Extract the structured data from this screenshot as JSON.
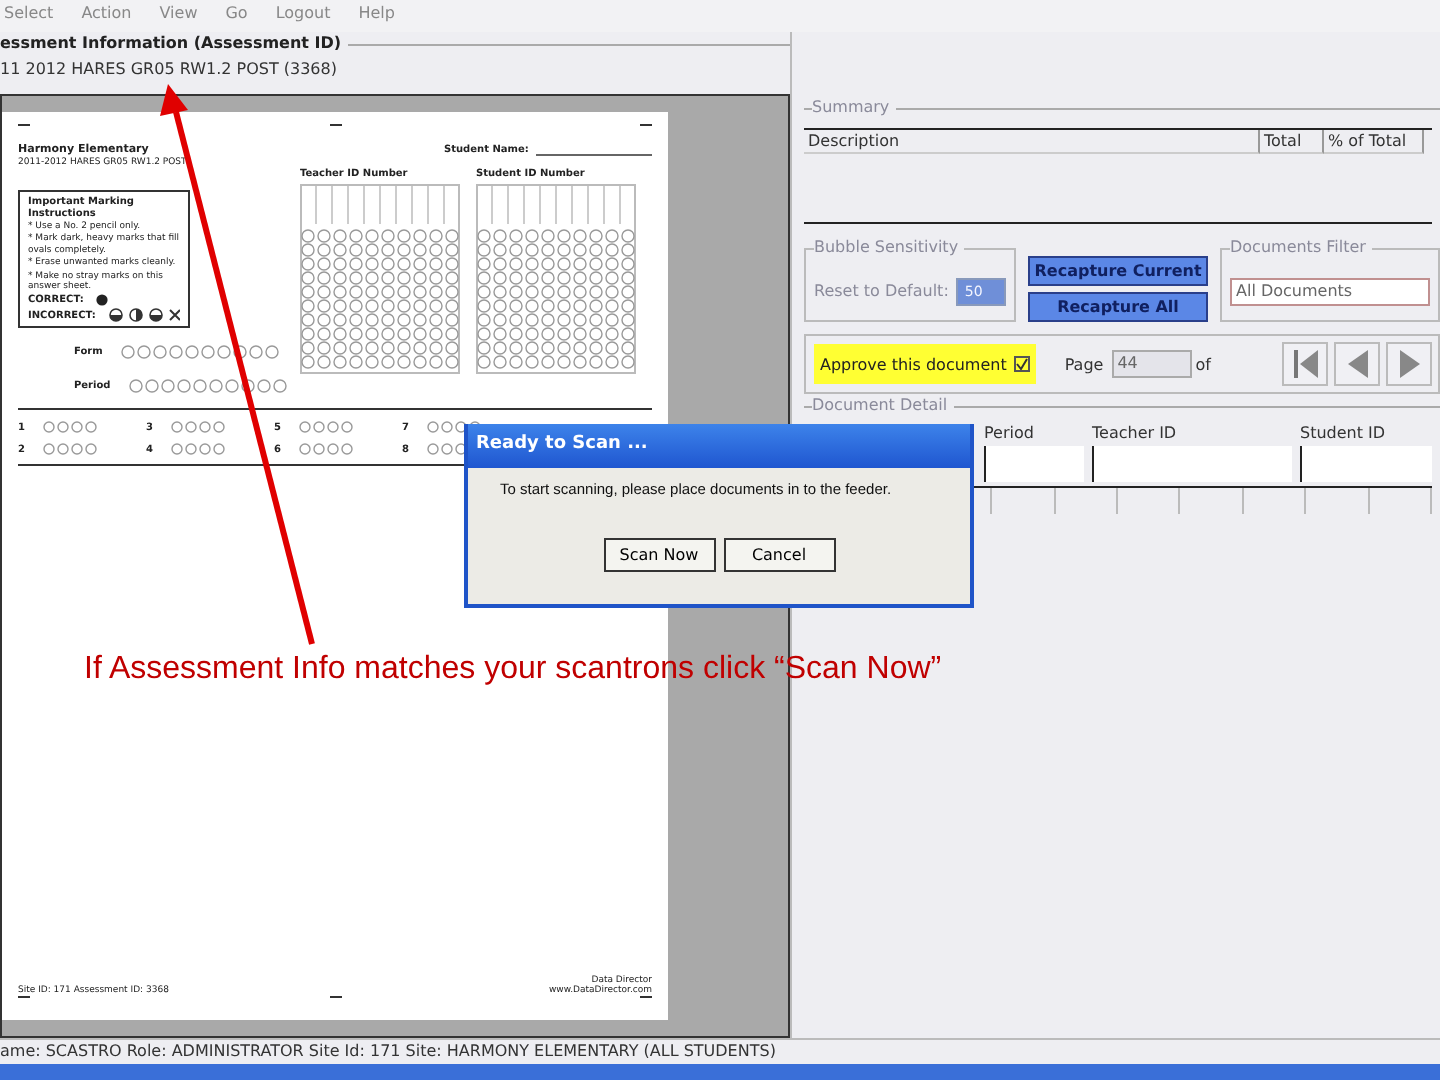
{
  "menu": [
    "Select",
    "Action",
    "View",
    "Go",
    "Logout",
    "Help"
  ],
  "assessment": {
    "legend": "essment Information (Assessment ID)",
    "value": "11 2012 HARES GR05 RW1.2 POST (3368)"
  },
  "sheet": {
    "school": "Harmony Elementary",
    "assessment": "2011-2012 HARES GR05 RW1.2 POST",
    "student_name_label": "Student Name:",
    "teacher_id_label": "Teacher ID Number",
    "student_id_label": "Student ID Number",
    "instructions_title": "Important Marking Instructions",
    "instructions": [
      "* Use a No. 2 pencil only.",
      "* Mark dark, heavy marks that fill ovals completely.",
      "* Erase unwanted marks cleanly.",
      "* Make no stray marks on this answer sheet."
    ],
    "correct_label": "CORRECT:",
    "incorrect_label": "INCORRECT:",
    "form_label": "Form",
    "period_label": "Period",
    "questions": [
      "1",
      "3",
      "5",
      "7",
      "2",
      "4",
      "6",
      "8"
    ],
    "footer_left": "Site ID: 171   Assessment ID: 3368",
    "footer_right": [
      "Data Director",
      "www.DataDirector.com"
    ]
  },
  "summary": {
    "legend": "Summary",
    "columns": [
      "Description",
      "Total",
      "% of Total"
    ]
  },
  "sensitivity": {
    "legend": "Bubble Sensitivity",
    "label": "Reset to Default:",
    "value": "50"
  },
  "recapture_buttons": [
    "Recapture Current",
    "Recapture All"
  ],
  "filter": {
    "legend": "Documents Filter",
    "value": "All Documents"
  },
  "approve": {
    "label": "Approve this document",
    "checked": true
  },
  "page": {
    "label": "Page",
    "value": "44",
    "of": "of"
  },
  "detail": {
    "legend": "Document Detail",
    "columns": [
      "Period",
      "Teacher ID",
      "Student ID"
    ]
  },
  "status_bar": "ame: SCASTRO   Role: ADMINISTRATOR   Site Id: 171   Site: HARMONY ELEMENTARY (ALL STUDENTS)",
  "dialog": {
    "title": "Ready to Scan ...",
    "message": "To start scanning, please place documents in to the feeder.",
    "buttons": [
      "Scan Now",
      "Cancel"
    ]
  },
  "annotation": "If Assessment Info matches your scantrons click “Scan Now”"
}
